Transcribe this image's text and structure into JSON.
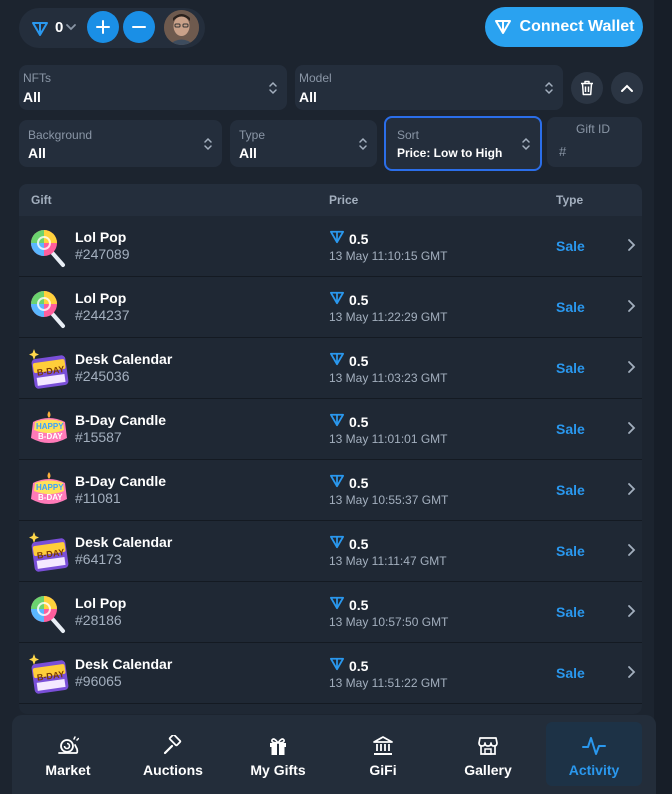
{
  "header": {
    "balance": "0",
    "connect_label": "Connect Wallet"
  },
  "filters": {
    "nfts": {
      "label": "NFTs",
      "value": "All"
    },
    "model": {
      "label": "Model",
      "value": "All"
    },
    "background": {
      "label": "Background",
      "value": "All"
    },
    "type": {
      "label": "Type",
      "value": "All"
    },
    "sort": {
      "label": "Sort",
      "value": "Price: Low to High"
    },
    "gift_id": {
      "label": "Gift ID",
      "placeholder": "#"
    }
  },
  "table": {
    "columns": {
      "gift": "Gift",
      "price": "Price",
      "type": "Type"
    },
    "rows": [
      {
        "name": "Lol Pop",
        "number": "#247089",
        "price": "0.5",
        "date": "13 May 11:10:15 GMT",
        "type": "Sale",
        "icon": "lollipop-icon"
      },
      {
        "name": "Lol Pop",
        "number": "#244237",
        "price": "0.5",
        "date": "13 May 11:22:29 GMT",
        "type": "Sale",
        "icon": "lollipop-icon"
      },
      {
        "name": "Desk Calendar",
        "number": "#245036",
        "price": "0.5",
        "date": "13 May 11:03:23 GMT",
        "type": "Sale",
        "icon": "calendar-icon"
      },
      {
        "name": "B-Day Candle",
        "number": "#15587",
        "price": "0.5",
        "date": "13 May 11:01:01 GMT",
        "type": "Sale",
        "icon": "candle-icon"
      },
      {
        "name": "B-Day Candle",
        "number": "#11081",
        "price": "0.5",
        "date": "13 May 10:55:37 GMT",
        "type": "Sale",
        "icon": "candle-icon"
      },
      {
        "name": "Desk Calendar",
        "number": "#64173",
        "price": "0.5",
        "date": "13 May 11:11:47 GMT",
        "type": "Sale",
        "icon": "calendar-icon"
      },
      {
        "name": "Lol Pop",
        "number": "#28186",
        "price": "0.5",
        "date": "13 May 10:57:50 GMT",
        "type": "Sale",
        "icon": "lollipop-icon"
      },
      {
        "name": "Desk Calendar",
        "number": "#96065",
        "price": "0.5",
        "date": "13 May 11:51:22 GMT",
        "type": "Sale",
        "icon": "calendar-icon"
      }
    ]
  },
  "nav": {
    "items": [
      {
        "label": "Market",
        "icon": "snail-icon"
      },
      {
        "label": "Auctions",
        "icon": "gavel-icon"
      },
      {
        "label": "My Gifts",
        "icon": "gift-icon"
      },
      {
        "label": "GiFi",
        "icon": "bank-icon"
      },
      {
        "label": "Gallery",
        "icon": "store-icon"
      },
      {
        "label": "Activity",
        "icon": "activity-icon"
      }
    ],
    "active": "Activity"
  },
  "colors": {
    "accent": "#2aa2f0",
    "sale": "#2a98ee",
    "background": "#1c242f",
    "panel": "#242e3c"
  }
}
